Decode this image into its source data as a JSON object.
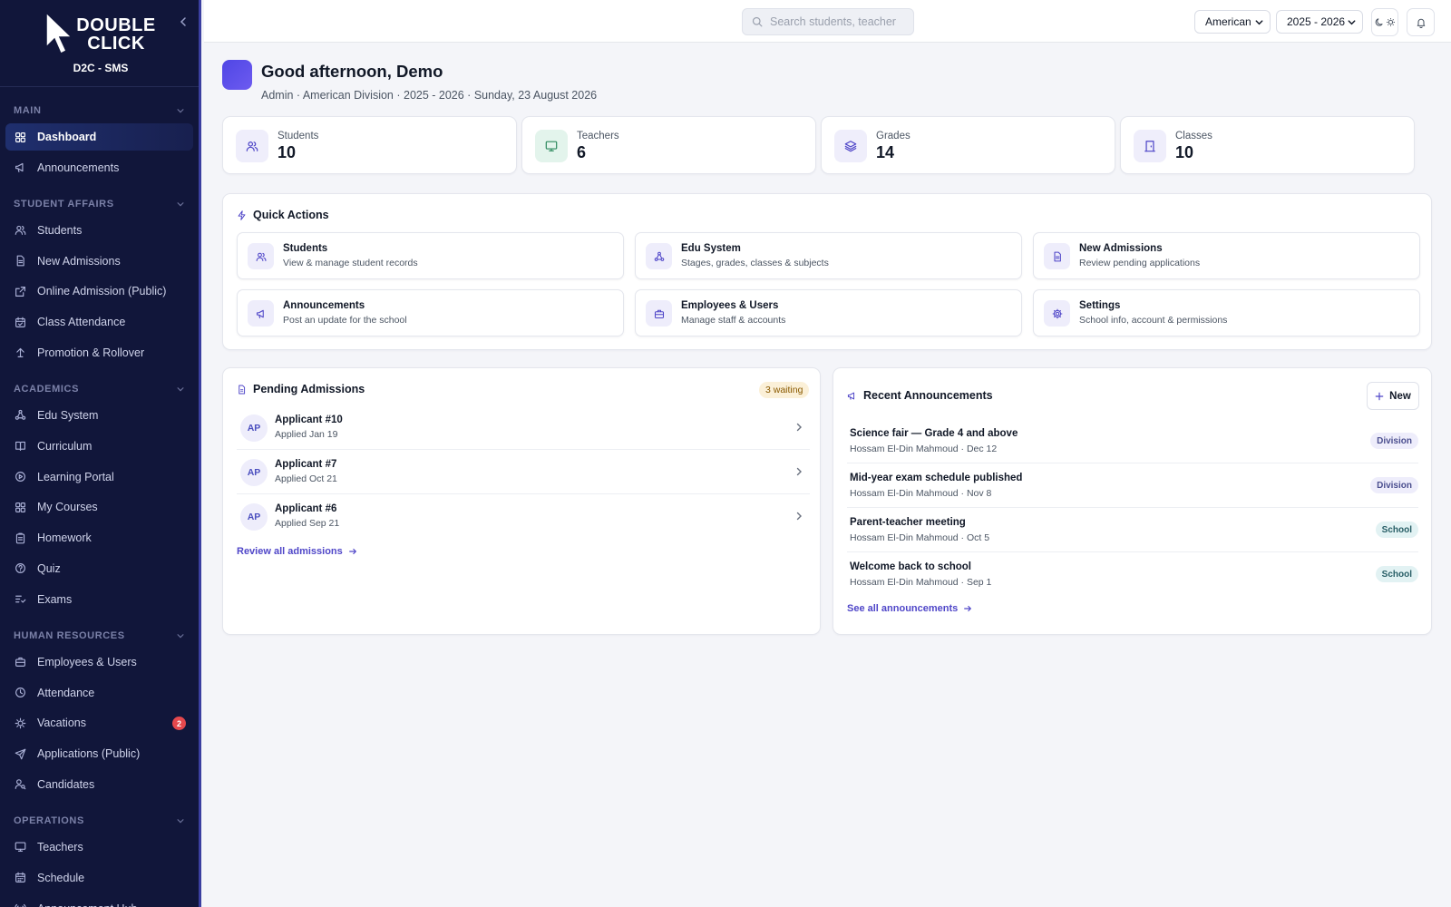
{
  "brand": {
    "logo_text_line1": "DOUBLE",
    "logo_text_line2": "CLICK",
    "app_name": "D2C - SMS"
  },
  "sidebar": {
    "sections": [
      {
        "title": "MAIN",
        "items": [
          {
            "label": "Dashboard",
            "icon": "grid-icon",
            "active": true
          },
          {
            "label": "Announcements",
            "icon": "megaphone-icon"
          }
        ]
      },
      {
        "title": "STUDENT AFFAIRS",
        "items": [
          {
            "label": "Students",
            "icon": "users-icon"
          },
          {
            "label": "New Admissions",
            "icon": "file-icon"
          },
          {
            "label": "Online Admission (Public)",
            "icon": "external-link-icon"
          },
          {
            "label": "Class Attendance",
            "icon": "calendar-check-icon"
          },
          {
            "label": "Promotion & Rollover",
            "icon": "arrow-up-icon"
          }
        ]
      },
      {
        "title": "ACADEMICS",
        "items": [
          {
            "label": "Edu System",
            "icon": "network-icon"
          },
          {
            "label": "Curriculum",
            "icon": "book-icon"
          },
          {
            "label": "Learning Portal",
            "icon": "play-circle-icon"
          },
          {
            "label": "My Courses",
            "icon": "grid-icon"
          },
          {
            "label": "Homework",
            "icon": "clipboard-icon"
          },
          {
            "label": "Quiz",
            "icon": "help-circle-icon"
          },
          {
            "label": "Exams",
            "icon": "list-check-icon"
          }
        ]
      },
      {
        "title": "HUMAN RESOURCES",
        "items": [
          {
            "label": "Employees & Users",
            "icon": "briefcase-icon"
          },
          {
            "label": "Attendance",
            "icon": "clock-icon"
          },
          {
            "label": "Vacations",
            "icon": "sun-icon",
            "badge": "2"
          },
          {
            "label": "Applications (Public)",
            "icon": "send-icon"
          },
          {
            "label": "Candidates",
            "icon": "user-search-icon"
          }
        ]
      },
      {
        "title": "OPERATIONS",
        "items": [
          {
            "label": "Teachers",
            "icon": "monitor-icon"
          },
          {
            "label": "Schedule",
            "icon": "calendar-icon"
          },
          {
            "label": "Announcement Hub",
            "icon": "broadcast-icon"
          }
        ]
      }
    ]
  },
  "topbar": {
    "search_placeholder": "Search students, teacher",
    "division_value": "American",
    "year_value": "2025 - 2026"
  },
  "greeting": {
    "title": "Good afternoon, Demo",
    "subtitle": "Admin · American Division · 2025 - 2026 · Sunday, 23 August 2026"
  },
  "stats": [
    {
      "label": "Students",
      "value": "10",
      "icon": "users-icon",
      "color": "#efeefb"
    },
    {
      "label": "Teachers",
      "value": "6",
      "icon": "monitor-icon",
      "color": "#e3f4ec"
    },
    {
      "label": "Grades",
      "value": "14",
      "icon": "layers-icon",
      "color": "#efeefb"
    },
    {
      "label": "Classes",
      "value": "10",
      "icon": "door-icon",
      "color": "#efeefb"
    }
  ],
  "quick_actions": {
    "title": "Quick Actions",
    "items": [
      {
        "title": "Students",
        "desc": "View & manage student records",
        "icon": "users-icon"
      },
      {
        "title": "Edu System",
        "desc": "Stages, grades, classes & subjects",
        "icon": "network-icon"
      },
      {
        "title": "New Admissions",
        "desc": "Review pending applications",
        "icon": "file-icon"
      },
      {
        "title": "Announcements",
        "desc": "Post an update for the school",
        "icon": "megaphone-icon"
      },
      {
        "title": "Employees & Users",
        "desc": "Manage staff & accounts",
        "icon": "briefcase-icon"
      },
      {
        "title": "Settings",
        "desc": "School info, account & permissions",
        "icon": "gear-icon"
      }
    ]
  },
  "pending": {
    "title": "Pending Admissions",
    "badge": "3 waiting",
    "rows": [
      {
        "initials": "AP",
        "name": "Applicant #10",
        "date": "Applied Jan 19"
      },
      {
        "initials": "AP",
        "name": "Applicant #7",
        "date": "Applied Oct 21"
      },
      {
        "initials": "AP",
        "name": "Applicant #6",
        "date": "Applied Sep 21"
      }
    ],
    "link": "Review all admissions"
  },
  "announcements": {
    "title": "Recent Announcements",
    "new_label": "New",
    "rows": [
      {
        "title": "Science fair — Grade 4 and above",
        "meta": "Hossam El-Din Mahmoud · Dec 12",
        "tag": "Division"
      },
      {
        "title": "Mid-year exam schedule published",
        "meta": "Hossam El-Din Mahmoud · Nov 8",
        "tag": "Division"
      },
      {
        "title": "Parent-teacher meeting",
        "meta": "Hossam El-Din Mahmoud · Oct 5",
        "tag": "School"
      },
      {
        "title": "Welcome back to school",
        "meta": "Hossam El-Din Mahmoud · Sep 1",
        "tag": "School"
      }
    ],
    "link": "See all announcements"
  },
  "colors": {
    "sidebar_bg": "#11163a",
    "accent": "#4f46e5",
    "page_bg": "#f4f5f9",
    "badge_red": "#e5484d"
  }
}
